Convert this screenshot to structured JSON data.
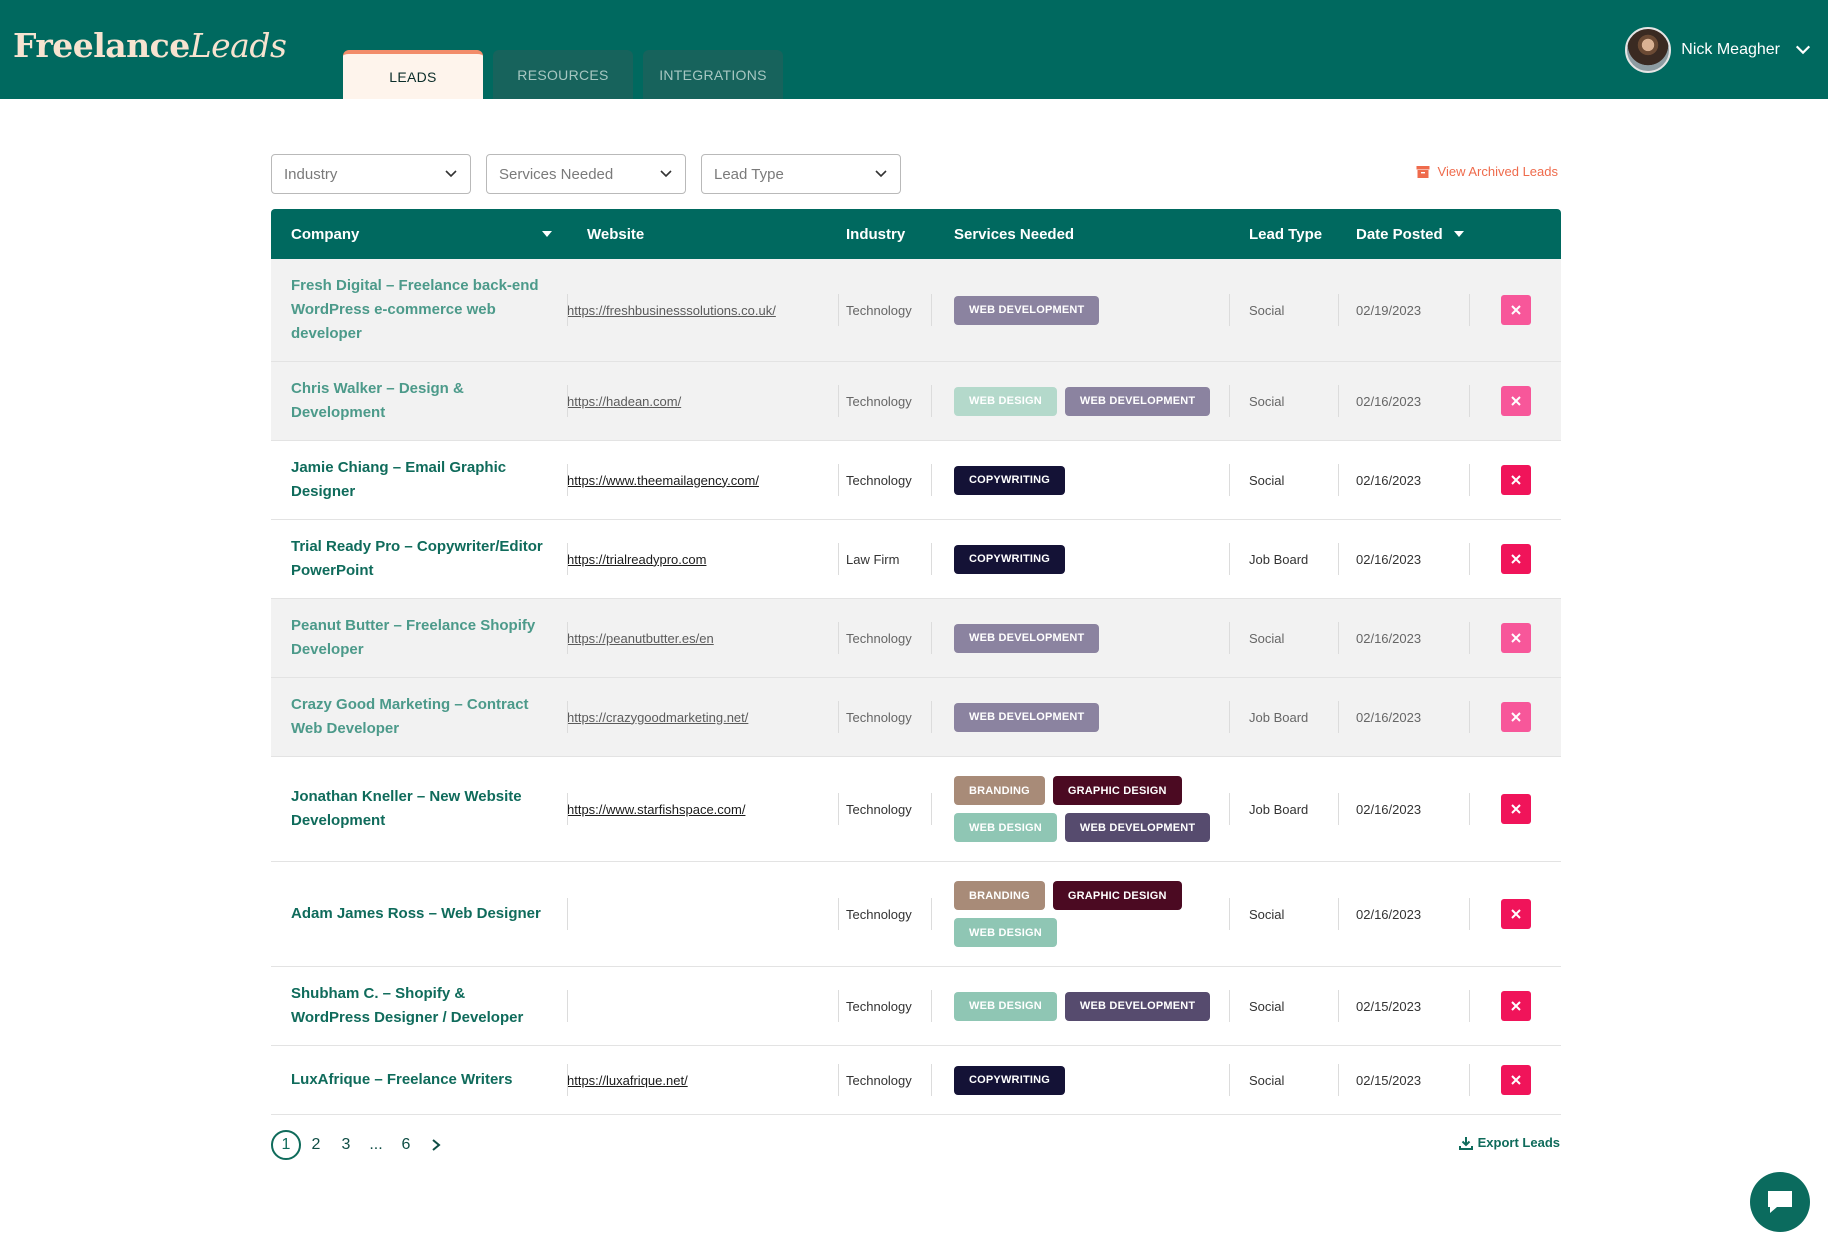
{
  "header": {
    "logo_part1": "Freelance",
    "logo_part2": "Leads",
    "tabs": [
      {
        "label": "Leads",
        "active": true
      },
      {
        "label": "Resources",
        "active": false
      },
      {
        "label": "Integrations",
        "active": false
      }
    ],
    "user_name": "Nick Meagher"
  },
  "filters": {
    "industry": "Industry",
    "services": "Services Needed",
    "lead_type": "Lead Type",
    "archived_link": "View Archived Leads"
  },
  "table": {
    "columns": {
      "company": "Company",
      "website": "Website",
      "industry": "Industry",
      "services": "Services Needed",
      "lead_type": "Lead Type",
      "date": "Date Posted"
    },
    "rows": [
      {
        "company": "Fresh Digital – Freelance back-end WordPress e-commerce web developer",
        "website": "https://freshbusinesssolutions.co.uk/",
        "industry": "Technology",
        "services": [
          "Web Development"
        ],
        "lead_type": "Social",
        "date": "02/19/2023",
        "muted": true
      },
      {
        "company": "Chris Walker – Design & Development",
        "website": "https://hadean.com/",
        "industry": "Technology",
        "services": [
          "Web Design",
          "Web Development"
        ],
        "lead_type": "Social",
        "date": "02/16/2023",
        "muted": true
      },
      {
        "company": "Jamie Chiang – Email Graphic Designer",
        "website": "https://www.theemailagency.com/",
        "industry": "Technology",
        "services": [
          "Copywriting"
        ],
        "lead_type": "Social",
        "date": "02/16/2023",
        "muted": false
      },
      {
        "company": "Trial Ready Pro – Copywriter/Editor PowerPoint",
        "website": "https://trialreadypro.com",
        "industry": "Law Firm",
        "services": [
          "Copywriting"
        ],
        "lead_type": "Job Board",
        "date": "02/16/2023",
        "muted": false
      },
      {
        "company": "Peanut Butter – Freelance Shopify Developer",
        "website": "https://peanutbutter.es/en",
        "industry": "Technology",
        "services": [
          "Web Development"
        ],
        "lead_type": "Social",
        "date": "02/16/2023",
        "muted": true
      },
      {
        "company": "Crazy Good Marketing – Contract Web Developer",
        "website": "https://crazygoodmarketing.net/",
        "industry": "Technology",
        "services": [
          "Web Development"
        ],
        "lead_type": "Job Board",
        "date": "02/16/2023",
        "muted": true
      },
      {
        "company": "Jonathan Kneller – New Website Development",
        "website": "https://www.starfishspace.com/",
        "industry": "Technology",
        "services": [
          "Branding",
          "Graphic Design",
          "Web Design",
          "Web Development"
        ],
        "lead_type": "Job Board",
        "date": "02/16/2023",
        "muted": false
      },
      {
        "company": "Adam James Ross – Web Designer",
        "website": "",
        "industry": "Technology",
        "services": [
          "Branding",
          "Graphic Design",
          "Web Design"
        ],
        "lead_type": "Social",
        "date": "02/16/2023",
        "muted": false
      },
      {
        "company": "Shubham C. – Shopify & WordPress Designer / Developer",
        "website": "",
        "industry": "Technology",
        "services": [
          "Web Design",
          "Web Development"
        ],
        "lead_type": "Social",
        "date": "02/15/2023",
        "muted": false
      },
      {
        "company": "LuxAfrique – Freelance Writers",
        "website": "https://luxafrique.net/",
        "industry": "Technology",
        "services": [
          "Copywriting"
        ],
        "lead_type": "Social",
        "date": "02/15/2023",
        "muted": false
      }
    ]
  },
  "pagination": {
    "pages": [
      "1",
      "2",
      "3",
      "...",
      "6"
    ],
    "current": "1"
  },
  "footer": {
    "export_label": "Export Leads"
  },
  "colors": {
    "brand_green": "#00695f",
    "accent_orange": "#ef6b4c",
    "delete_pink": "#f0145a"
  }
}
